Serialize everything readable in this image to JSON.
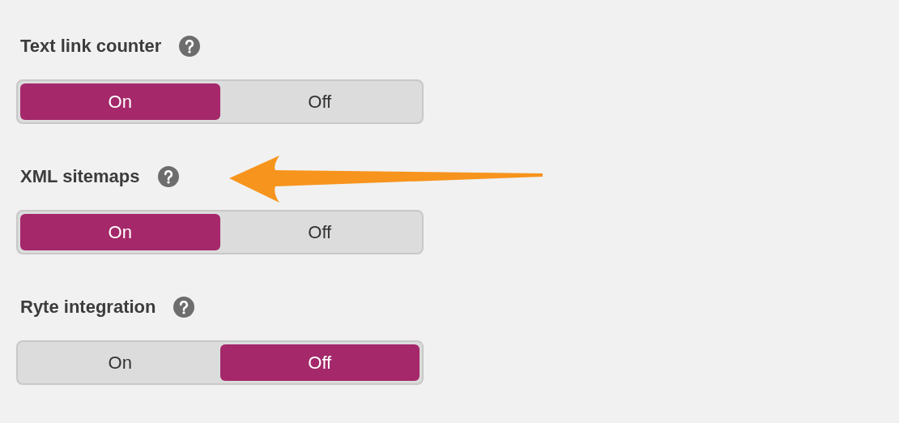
{
  "settings": [
    {
      "label": "Text link counter",
      "options": [
        {
          "label": "On",
          "selected": true
        },
        {
          "label": "Off",
          "selected": false
        }
      ]
    },
    {
      "label": "XML sitemaps",
      "options": [
        {
          "label": "On",
          "selected": true
        },
        {
          "label": "Off",
          "selected": false
        }
      ]
    },
    {
      "label": "Ryte integration",
      "options": [
        {
          "label": "On",
          "selected": false
        },
        {
          "label": "Off",
          "selected": true
        }
      ]
    }
  ]
}
